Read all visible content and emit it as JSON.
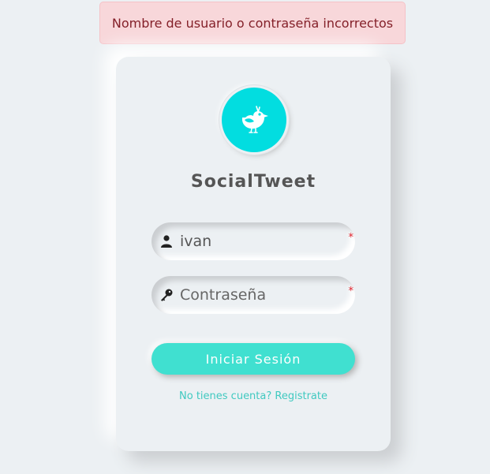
{
  "alert": {
    "message": "Nombre de usuario o contraseña incorrectos"
  },
  "brand": {
    "name": "SocialTweet",
    "icon": "bird-icon"
  },
  "form": {
    "username": {
      "value": "ivan",
      "required_mark": "*",
      "icon": "user-icon"
    },
    "password": {
      "placeholder": "Contraseña",
      "value": "",
      "required_mark": "*",
      "icon": "key-icon"
    },
    "submit_label": "Iniciar Sesión",
    "register_link": "No tienes cuenta? Registrate"
  },
  "colors": {
    "background": "#ecf0f3",
    "accent": "#40e0d0",
    "logo": "#02dde0",
    "alert_bg": "#f8d7da",
    "alert_text": "#842029"
  }
}
